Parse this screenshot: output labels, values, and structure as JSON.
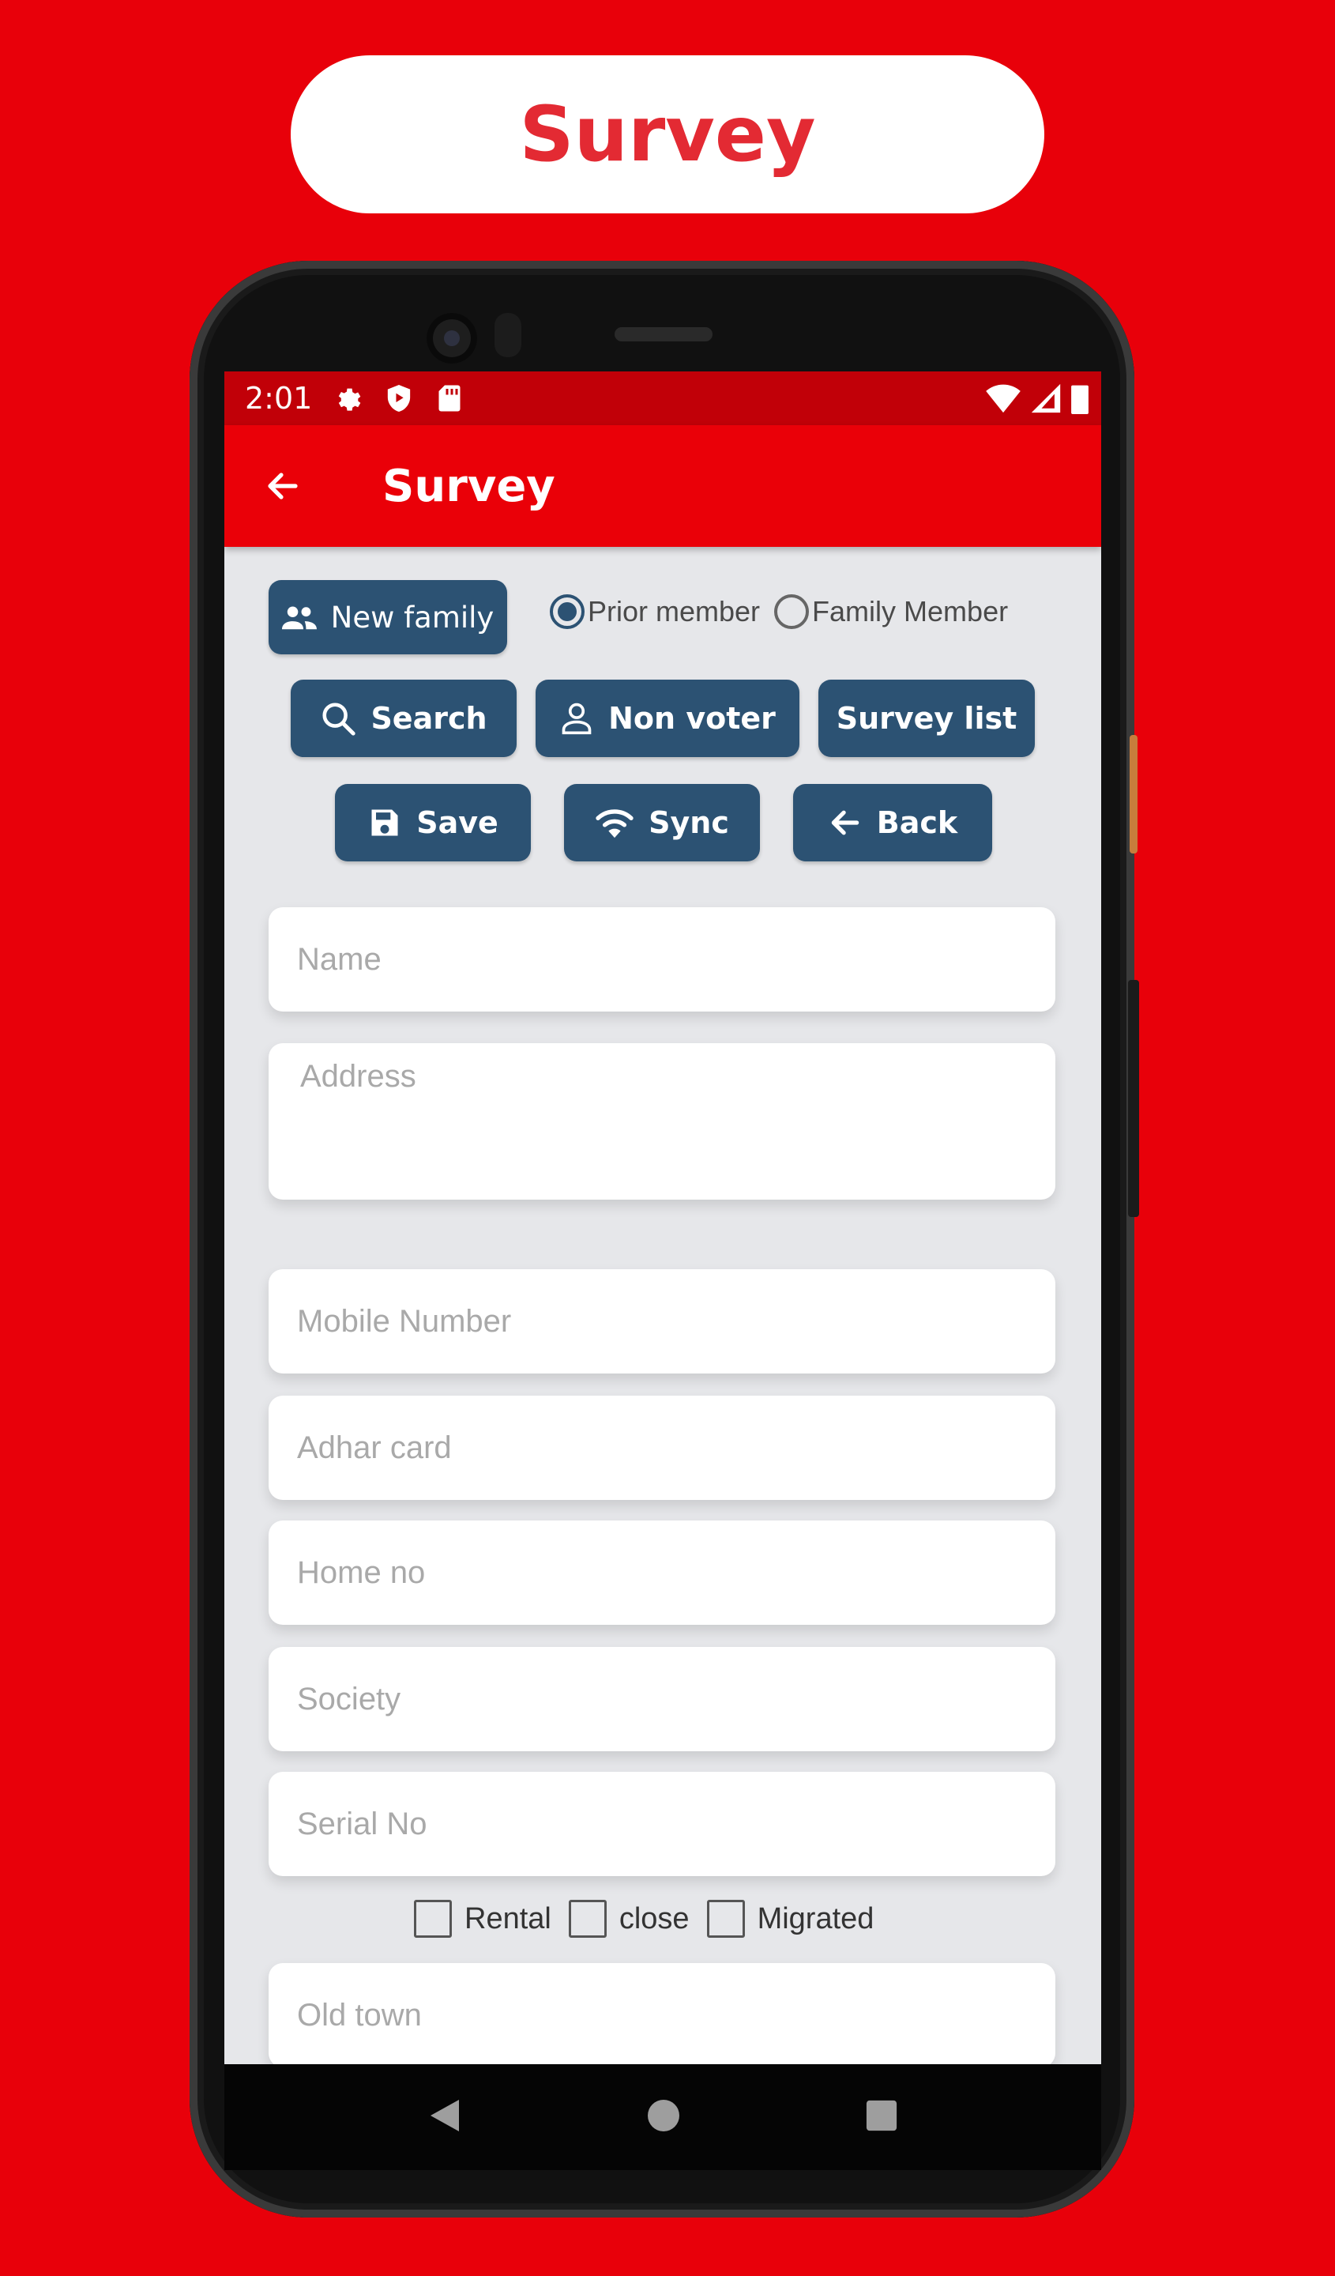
{
  "promo": {
    "title": "Survey"
  },
  "status_bar": {
    "time": "2:01"
  },
  "app_bar": {
    "title": "Survey"
  },
  "buttons": {
    "new_family": "New family",
    "search": "Search",
    "non_voter": "Non voter",
    "survey_list": "Survey list",
    "save": "Save",
    "sync": "Sync",
    "back": "Back"
  },
  "radios": {
    "prior_member": "Prior member",
    "family_member": "Family Member",
    "selected": "prior_member"
  },
  "form": {
    "name": {
      "placeholder": "Name",
      "value": ""
    },
    "address": {
      "placeholder": "Address",
      "value": ""
    },
    "mobile": {
      "placeholder": "Mobile Number",
      "value": ""
    },
    "adhar": {
      "placeholder": "Adhar card",
      "value": ""
    },
    "home_no": {
      "placeholder": "Home no",
      "value": ""
    },
    "society": {
      "placeholder": "Society",
      "value": ""
    },
    "serial_no": {
      "placeholder": "Serial No",
      "value": ""
    },
    "old_town": {
      "placeholder": "Old town",
      "value": ""
    }
  },
  "checkboxes": {
    "rental": "Rental",
    "close": "close",
    "migrated": "Migrated"
  },
  "colors": {
    "background": "#e8000a",
    "app_bar": "#ea0008",
    "status_bar": "#c10008",
    "button": "#2c5273",
    "promo_text": "#e32a33"
  }
}
